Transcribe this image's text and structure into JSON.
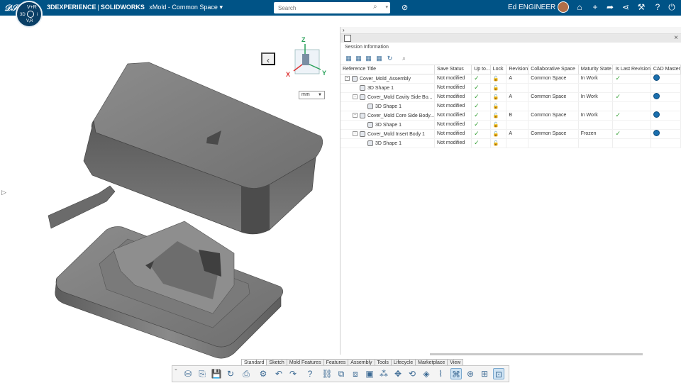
{
  "topbar": {
    "app_brand": "3DEXPERIENCE",
    "app_sep": "|",
    "app_product": "SOLIDWORKS",
    "app_name": "xMold - Common Space",
    "search_placeholder": "Search",
    "username": "Ed ENGINEER",
    "compass": {
      "top": "V+R",
      "left": "3D",
      "right": "i",
      "bottom": "V,R"
    }
  },
  "viewport": {
    "unit": "mm",
    "axis_z": "Z",
    "axis_x": "X",
    "axis_y": "Y"
  },
  "panel": {
    "title": "Session Information",
    "columns": [
      "Reference Title",
      "Save Status",
      "Up to...",
      "Lock",
      "Revision",
      "Collaborative Space",
      "Maturity State",
      "Is Last Revision",
      "CAD Master"
    ],
    "rows": [
      {
        "indent": 0,
        "toggle": "-",
        "title": "Cover_Mold_Assembly",
        "save": "Not modified",
        "upto": true,
        "lock": true,
        "rev": "A",
        "space": "Common Space",
        "maturity": "In Work",
        "last": true,
        "master": true
      },
      {
        "indent": 1,
        "toggle": "",
        "title": "3D Shape 1",
        "save": "Not modified",
        "upto": true,
        "lock": true,
        "rev": "",
        "space": "",
        "maturity": "",
        "last": false,
        "master": false
      },
      {
        "indent": 1,
        "toggle": "-",
        "title": "Cover_Mold Cavity Side Bo...",
        "save": "Not modified",
        "upto": true,
        "lock": true,
        "rev": "A",
        "space": "Common Space",
        "maturity": "In Work",
        "last": true,
        "master": true
      },
      {
        "indent": 2,
        "toggle": "",
        "title": "3D Shape 1",
        "save": "Not modified",
        "upto": true,
        "lock": true,
        "rev": "",
        "space": "",
        "maturity": "",
        "last": false,
        "master": false
      },
      {
        "indent": 1,
        "toggle": "-",
        "title": "Cover_Mold Core Side Body...",
        "save": "Not modified",
        "upto": true,
        "lock": true,
        "rev": "B",
        "space": "Common Space",
        "maturity": "In Work",
        "last": true,
        "master": true
      },
      {
        "indent": 2,
        "toggle": "",
        "title": "3D Shape 1",
        "save": "Not modified",
        "upto": true,
        "lock": true,
        "rev": "",
        "space": "",
        "maturity": "",
        "last": false,
        "master": false
      },
      {
        "indent": 1,
        "toggle": "-",
        "title": "Cover_Mold Insert Body 1",
        "save": "Not modified",
        "upto": true,
        "lock": true,
        "rev": "A",
        "space": "Common Space",
        "maturity": "Frozen",
        "last": true,
        "master": true
      },
      {
        "indent": 2,
        "toggle": "",
        "title": "3D Shape 1",
        "save": "Not modified",
        "upto": true,
        "lock": true,
        "rev": "",
        "space": "",
        "maturity": "",
        "last": false,
        "master": false
      }
    ]
  },
  "command_tabs": [
    "Standard",
    "Sketch",
    "Mold Features",
    "Features",
    "Assembly",
    "Tools",
    "Lifecycle",
    "Marketplace",
    "View"
  ],
  "active_tab": "Standard",
  "colors": {
    "topbar": "#005386",
    "accent": "#1a6fae",
    "check": "#3aa23a"
  }
}
